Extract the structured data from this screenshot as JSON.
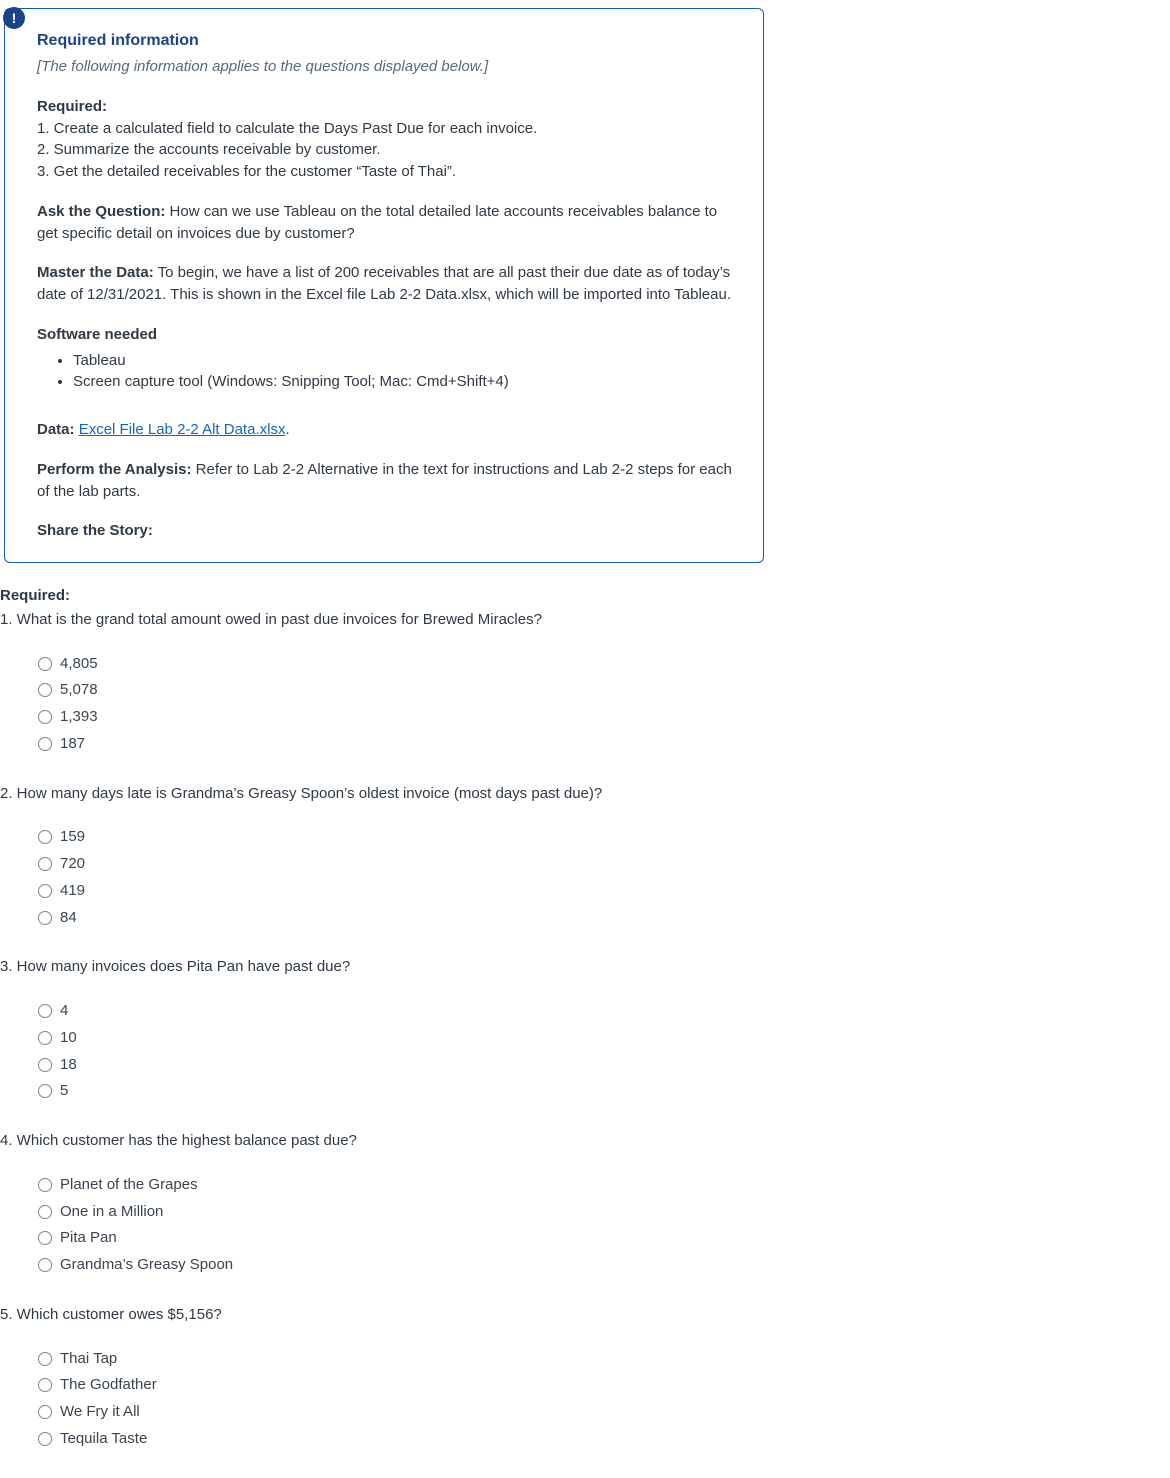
{
  "info": {
    "icon_glyph": "!",
    "title": "Required information",
    "subtitle": "[The following information applies to the questions displayed below.]",
    "required_label": "Required:",
    "required_steps": [
      "1. Create a calculated field to calculate the Days Past Due for each invoice.",
      "2. Summarize the accounts receivable by customer.",
      "3. Get the detailed receivables for the customer “Taste of Thai”."
    ],
    "ask_label": "Ask the Question:",
    "ask_text": " How can we use Tableau on the total detailed late accounts receivables balance to get specific detail on invoices due by customer?",
    "master_label": "Master the Data:",
    "master_text": " To begin, we have a list of 200 receivables that are all past their due date as of today’s date of 12/31/2021. This is shown in the Excel file Lab 2-2 Data.xlsx, which will be imported into Tableau.",
    "software_label": "Software needed",
    "software_items": [
      "Tableau",
      "Screen capture tool (Windows: Snipping Tool; Mac: Cmd+Shift+4)"
    ],
    "data_label": "Data: ",
    "data_link": "Excel File Lab 2-2 Alt Data.xlsx",
    "data_after": ".",
    "perform_label": "Perform the Analysis:",
    "perform_text": " Refer to Lab 2-2 Alternative in the text for instructions and Lab 2-2 steps for each of the lab parts.",
    "share_label": "Share the Story:"
  },
  "questions_header": "Required:",
  "questions": [
    {
      "text": "1. What is the grand total amount owed in past due invoices for Brewed Miracles?",
      "options": [
        "4,805",
        "5,078",
        "1,393",
        "187"
      ]
    },
    {
      "text": "2. How many days late is Grandma’s Greasy Spoon’s oldest invoice (most days past due)?",
      "options": [
        "159",
        "720",
        "419",
        "84"
      ]
    },
    {
      "text": "3. How many invoices does Pita Pan have past due?",
      "options": [
        "4",
        "10",
        "18",
        "5"
      ]
    },
    {
      "text": "4. Which customer has the highest balance past due?",
      "options": [
        "Planet of the Grapes",
        "One in a Million",
        "Pita Pan",
        "Grandma’s Greasy Spoon"
      ]
    },
    {
      "text": "5. Which customer owes $5,156?",
      "options": [
        "Thai Tap",
        "The Godfather",
        "We Fry it All",
        "Tequila Taste"
      ]
    }
  ]
}
